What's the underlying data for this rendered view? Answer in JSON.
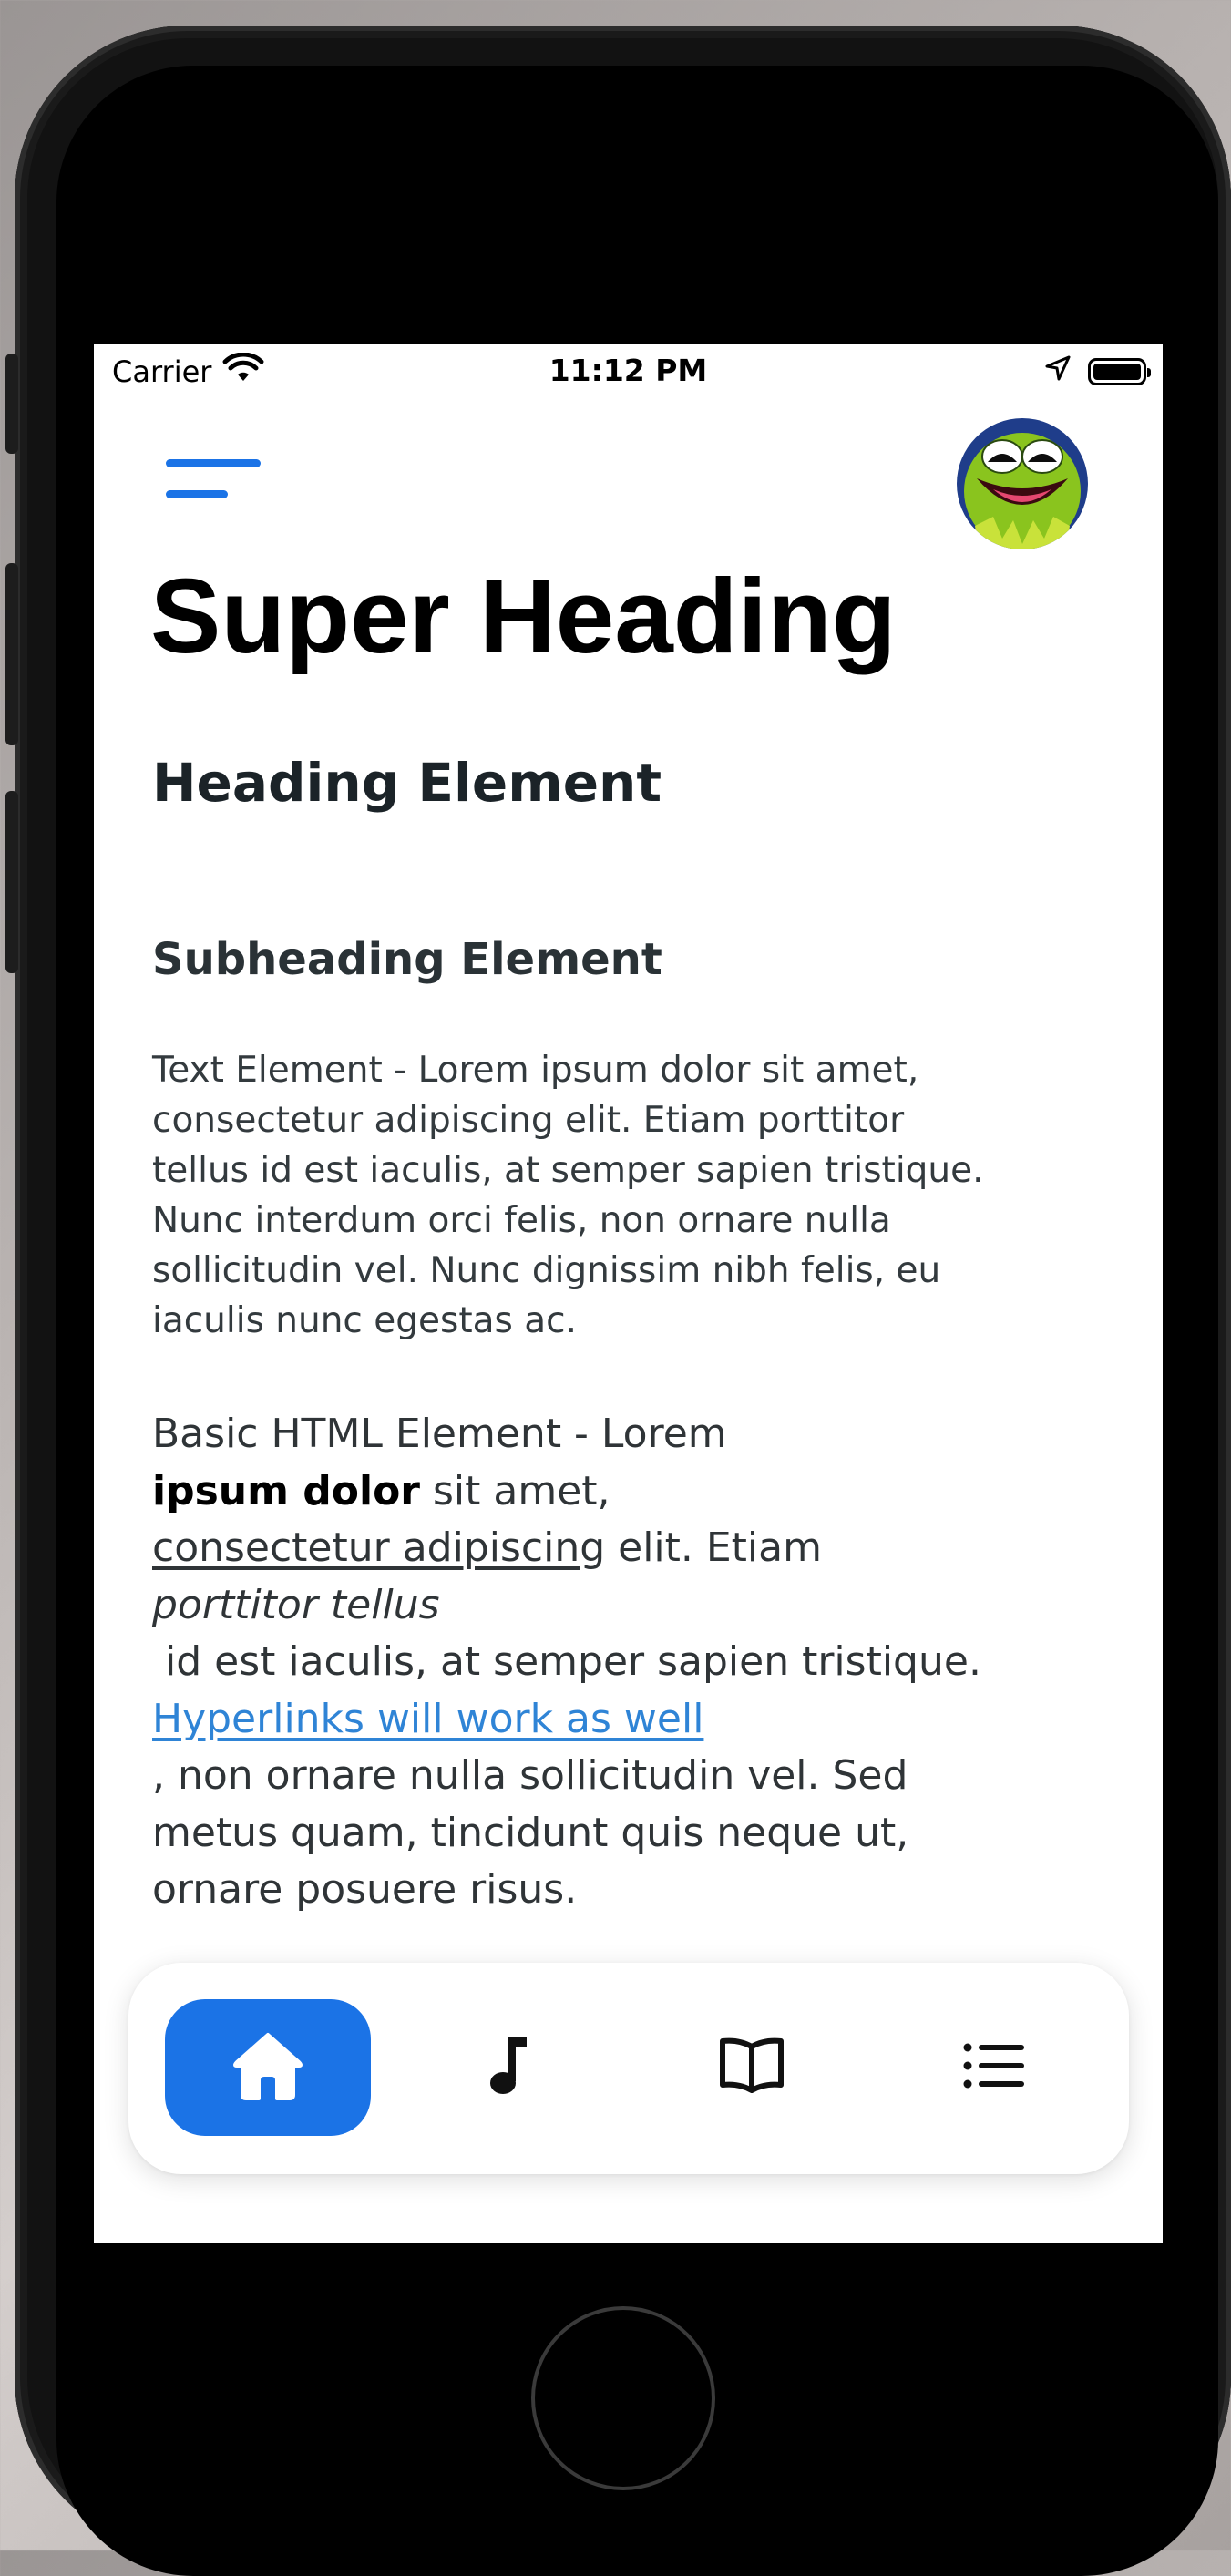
{
  "status_bar": {
    "carrier": "Carrier",
    "time": "11:12 PM"
  },
  "header": {
    "menu_icon": "hamburger-menu-icon",
    "avatar": "kermit-avatar"
  },
  "content": {
    "super_heading": "Super Heading",
    "heading_element": "Heading Element",
    "subheading": "Subheading Element",
    "text_element_lines": [
      "Text Element - Lorem ipsum dolor sit amet,",
      "consectetur adipiscing elit. Etiam porttitor",
      "tellus id est iaculis, at semper sapien tristique.",
      "Nunc interdum orci felis, non ornare nulla",
      "sollicitudin vel. Nunc dignissim nibh felis, eu",
      "iaculis nunc egestas ac."
    ],
    "html_element": {
      "line1": "Basic HTML Element - Lorem",
      "bold": "ipsum dolor",
      "line2_rest": " sit amet,",
      "underlined": "consectetur adipiscin",
      "line3_rest": "g elit. Etiam",
      "italic": "porttitor tellus",
      "line5": " id est iaculis, at semper sapien tristique.",
      "link": "Hyperlinks will work as well",
      "line7": ", non ornare nulla sollicitudin vel. Sed",
      "line8": "metus quam, tincidunt quis neque ut,",
      "line9": "ornare posuere risus."
    }
  },
  "tab_bar": {
    "tabs": [
      {
        "icon": "home-icon",
        "active": true
      },
      {
        "icon": "music-note-icon",
        "active": false
      },
      {
        "icon": "book-icon",
        "active": false
      },
      {
        "icon": "list-icon",
        "active": false
      }
    ],
    "active_color": "#1b73e6"
  },
  "colors": {
    "accent": "#1b73e6",
    "link": "#2f84d6"
  }
}
